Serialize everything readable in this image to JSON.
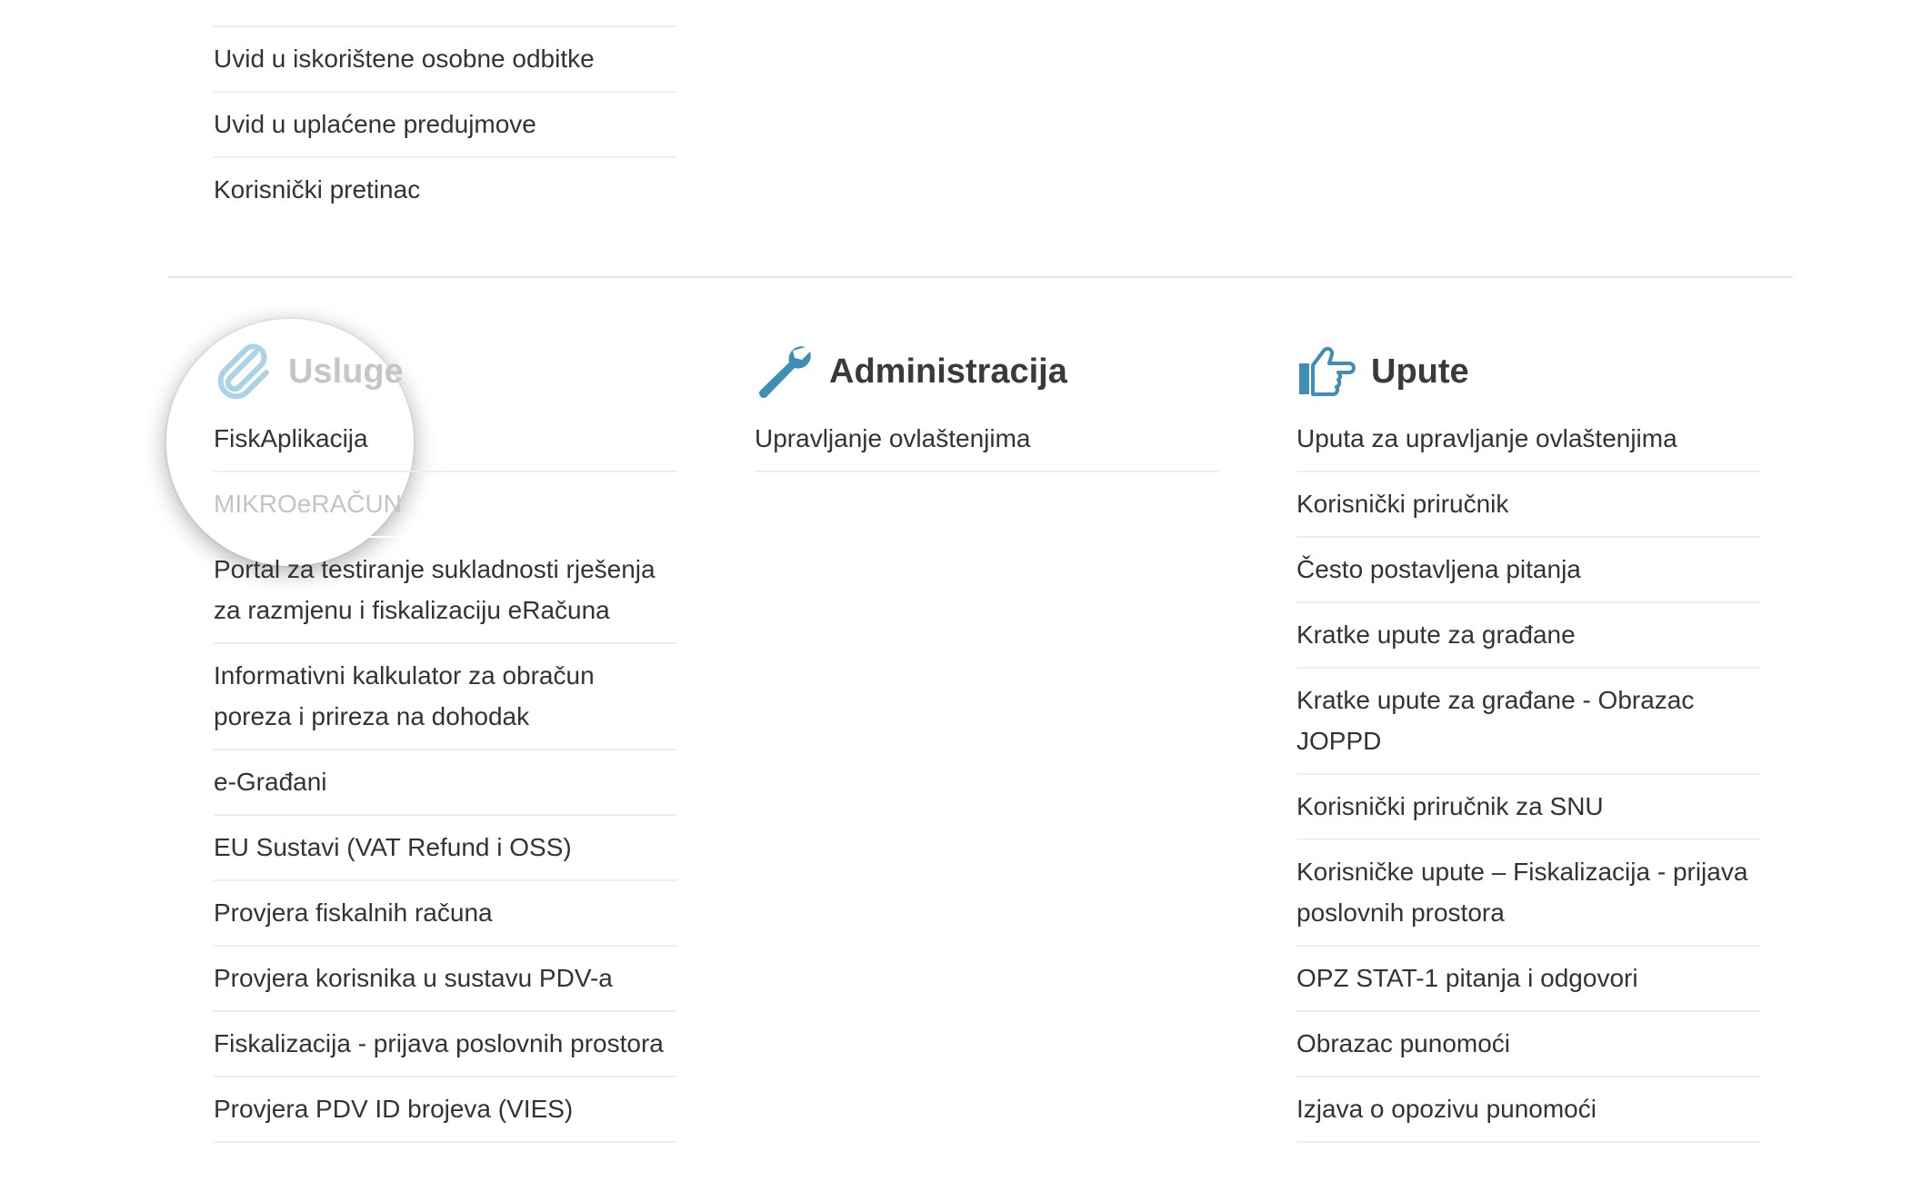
{
  "top_links": [
    "Uvid u iskorištene osobne odbitke",
    "Uvid u uplaćene predujmove",
    "Korisnički pretinac"
  ],
  "sections": {
    "usluge": {
      "title": "Usluge",
      "icon": "paperclip-icon",
      "links": [
        "FiskAplikacija",
        "MIKROeRAČUN",
        "Portal za testiranje sukladnosti rješenja za razmjenu i fiskalizaciju eRačuna",
        "Informativni kalkulator za obračun poreza i prireza na dohodak",
        "e-Građani",
        "EU Sustavi (VAT Refund i OSS)",
        "Provjera fiskalnih računa",
        "Provjera korisnika u sustavu PDV-a",
        "Fiskalizacija - prijava poslovnih prostora",
        "Provjera PDV ID brojeva (VIES)"
      ]
    },
    "administracija": {
      "title": "Administracija",
      "icon": "wrench-icon",
      "links": [
        "Upravljanje ovlaštenjima"
      ]
    },
    "upute": {
      "title": "Upute",
      "icon": "pointing-hand-icon",
      "links": [
        "Uputa za upravljanje ovlaštenjima",
        "Korisnički priručnik",
        "Često postavljena pitanja",
        "Kratke upute za građane",
        "Kratke upute za građane - Obrazac JOPPD",
        "Korisnički priručnik za SNU",
        "Korisničke upute – Fiskalizacija - prijava poslovnih prostora",
        "OPZ STAT-1 pitanja i odgovori",
        "Obrazac punomoći",
        "Izjava o opozivu punomoći"
      ]
    }
  },
  "colors": {
    "icon_blue": "#3d8fb3",
    "icon_light_blue": "#a9d3e6",
    "text": "#333333",
    "faded_text": "#c4c4c4"
  }
}
